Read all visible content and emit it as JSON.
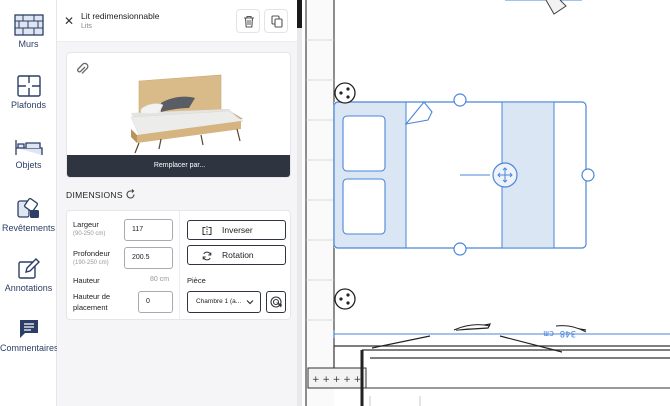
{
  "rail": {
    "items": [
      {
        "label": "Murs",
        "icon": "walls-icon"
      },
      {
        "label": "Plafonds",
        "icon": "ceilings-icon"
      },
      {
        "label": "Objets",
        "icon": "objects-icon"
      },
      {
        "label": "Revêtements",
        "icon": "coverings-icon"
      },
      {
        "label": "Annotations",
        "icon": "annotations-icon"
      },
      {
        "label": "Commentaires",
        "icon": "comments-icon"
      }
    ]
  },
  "panel": {
    "object_name": "Lit redimensionnable",
    "object_category": "Lits",
    "replace_label": "Remplacer par...",
    "dimensions_title": "DIMENSIONS",
    "width_label": "Largeur",
    "width_range": "(90-250 cm)",
    "width_value": "117",
    "depth_label": "Profondeur",
    "depth_range": "(190-250 cm)",
    "depth_value": "200.5",
    "height_label": "Hauteur",
    "height_value": "80 cm",
    "placement_label_1": "Hauteur de",
    "placement_label_2": "placement",
    "placement_value": "0",
    "invert_label": "Inverser",
    "rotation_label": "Rotation",
    "room_label": "Pièce",
    "room_value": "Chambre 1 (a..."
  },
  "canvas": {
    "dimension_text": "348 cm",
    "accent": "#4a86d8",
    "selection_fill": "#e7eef8"
  }
}
